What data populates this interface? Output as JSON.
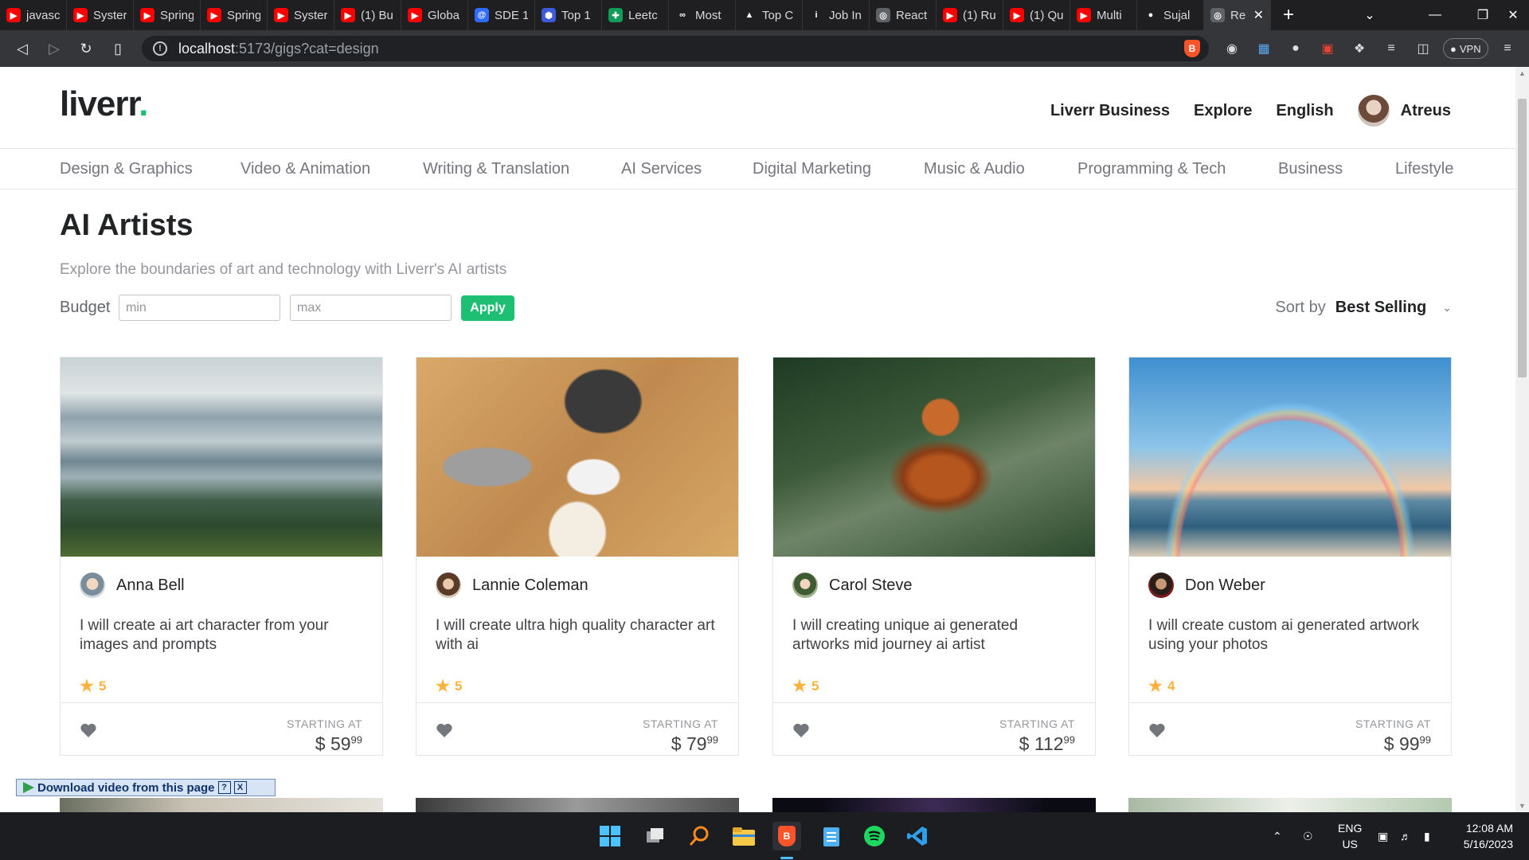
{
  "browser": {
    "tabs": [
      {
        "title": "javasc",
        "icon": "youtube-icon"
      },
      {
        "title": "Syster",
        "icon": "youtube-icon"
      },
      {
        "title": "Spring",
        "icon": "youtube-icon"
      },
      {
        "title": "Spring",
        "icon": "youtube-icon"
      },
      {
        "title": "Syster",
        "icon": "youtube-icon"
      },
      {
        "title": "(1) Bu",
        "icon": "youtube-icon"
      },
      {
        "title": "Globa",
        "icon": "youtube-icon"
      },
      {
        "title": "SDE 1",
        "icon": "at-icon"
      },
      {
        "title": "Top 1",
        "icon": "hexagon-icon"
      },
      {
        "title": "Leetc",
        "icon": "sheets-icon"
      },
      {
        "title": "Most",
        "icon": "infinity-icon"
      },
      {
        "title": "Top C",
        "icon": "mountain-icon"
      },
      {
        "title": "Job In",
        "icon": "info-icon"
      },
      {
        "title": "React",
        "icon": "globe-icon"
      },
      {
        "title": "(1) Ru",
        "icon": "youtube-icon"
      },
      {
        "title": "(1) Qu",
        "icon": "youtube-icon"
      },
      {
        "title": "Multi",
        "icon": "youtube-icon"
      },
      {
        "title": "Sujal",
        "icon": "github-icon"
      },
      {
        "title": "Re",
        "icon": "globe-icon"
      }
    ],
    "url_host": "localhost",
    "url_path": ":5173/gigs?cat=design",
    "vpn_label": "VPN"
  },
  "site": {
    "logo_text": "liverr",
    "logo_dot": ".",
    "nav": {
      "business": "Liverr Business",
      "explore": "Explore",
      "language": "English",
      "user": "Atreus"
    },
    "categories": [
      "Design & Graphics",
      "Video & Animation",
      "Writing & Translation",
      "AI Services",
      "Digital Marketing",
      "Music & Audio",
      "Programming & Tech",
      "Business",
      "Lifestyle"
    ]
  },
  "gigs_page": {
    "title": "AI Artists",
    "subtitle": "Explore the boundaries of art and technology with Liverr's AI artists",
    "budget_label": "Budget",
    "min_placeholder": "min",
    "max_placeholder": "max",
    "apply_label": "Apply",
    "sort_label": "Sort by",
    "sort_value": "Best Selling"
  },
  "gigs": [
    {
      "seller": "Anna Bell",
      "description": "I will create ai art character from your images and prompts",
      "rating": "5",
      "starting_label": "STARTING AT",
      "price_main": "$ 59",
      "price_cents": "99",
      "image": "mountain-landscape"
    },
    {
      "seller": "Lannie Coleman",
      "description": "I will create ultra high quality character art with ai",
      "rating": "5",
      "starting_label": "STARTING AT",
      "price_main": "$ 79",
      "price_cents": "99",
      "image": "desk-workspace"
    },
    {
      "seller": "Carol Steve",
      "description": "I will creating unique ai generated artworks mid journey ai artist",
      "rating": "5",
      "starting_label": "STARTING AT",
      "price_main": "$ 112",
      "price_cents": "99",
      "image": "squirrel"
    },
    {
      "seller": "Don Weber",
      "description": "I will create custom ai generated artwork using your photos",
      "rating": "4",
      "starting_label": "STARTING AT",
      "price_main": "$ 99",
      "price_cents": "99",
      "image": "rainbow-beach"
    }
  ],
  "download_bar": {
    "label": "Download video from this page",
    "help": "?",
    "close": "X"
  },
  "taskbar": {
    "lang_top": "ENG",
    "lang_bottom": "US",
    "time": "12:08 AM",
    "date": "5/16/2023"
  },
  "colors": {
    "accent": "#1dbf73",
    "star": "#ffb33e",
    "text_dark": "#222325",
    "text_muted": "#74767e"
  }
}
